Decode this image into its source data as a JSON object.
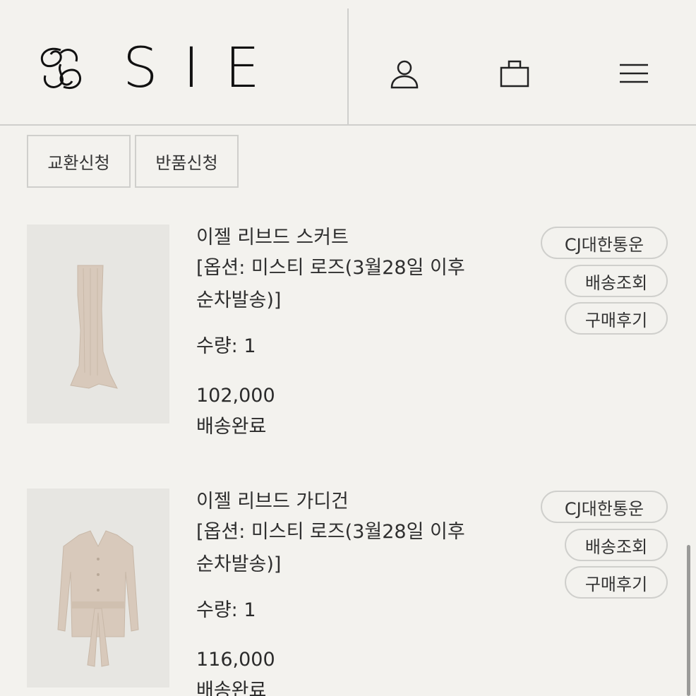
{
  "header": {
    "logo_text": "SIE",
    "icons": [
      "user-icon",
      "bag-icon",
      "menu-icon"
    ]
  },
  "actions": {
    "exchange_label": "교환신청",
    "return_label": "반품신청"
  },
  "orders": [
    {
      "name": "이젤 리브드 스커트",
      "option_line1": "[옵션: 미스티 로즈(3월28일 이후",
      "option_line2": "순차발송)]",
      "quantity": "수량: 1",
      "price": "102,000",
      "status": "배송완료",
      "courier_label": "CJ대한통운",
      "track_label": "배송조회",
      "review_label": "구매후기"
    },
    {
      "name": "이젤 리브드 가디건",
      "option_line1": "[옵션: 미스티 로즈(3월28일 이후",
      "option_line2": "순차발송)]",
      "quantity": "수량: 1",
      "price": "116,000",
      "status": "배송완료",
      "courier_label": "CJ대한통운",
      "track_label": "배송조회",
      "review_label": "구매후기"
    }
  ],
  "colors": {
    "background": "#f3f2ee",
    "border": "#cfcfcc",
    "text": "#2b2b2b",
    "product": "#d8c9bb"
  }
}
